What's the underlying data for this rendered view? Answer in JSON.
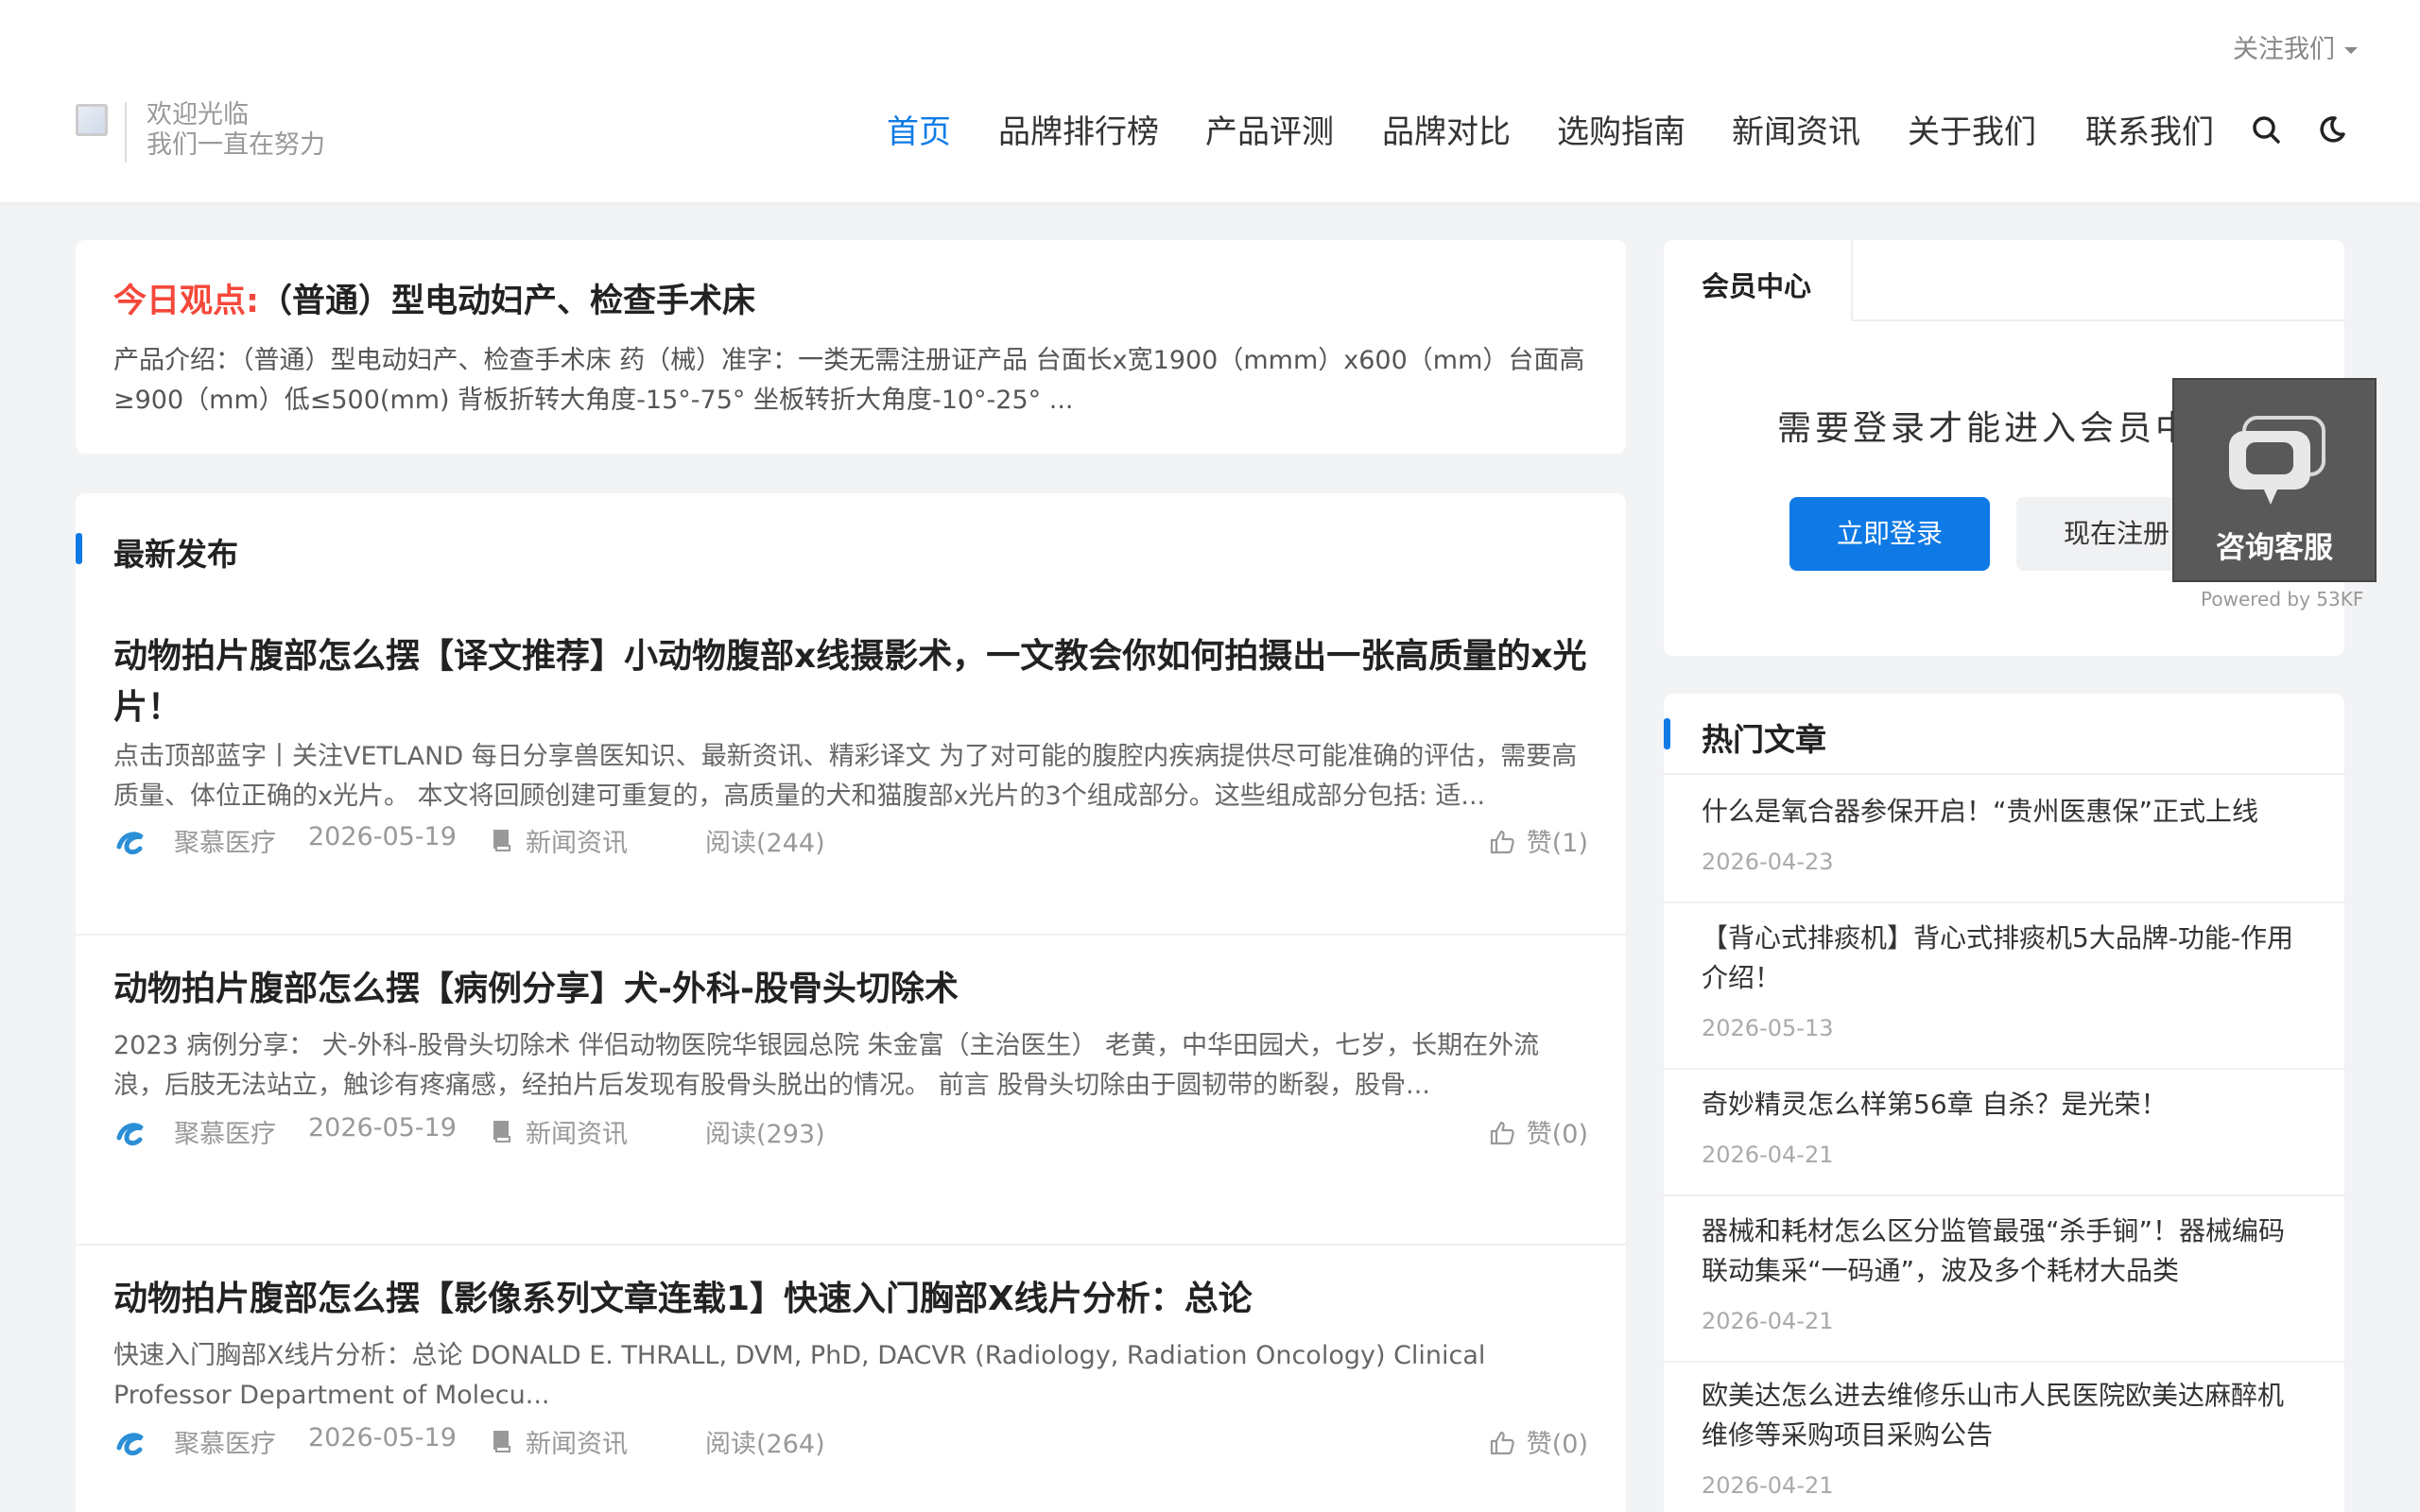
{
  "header": {
    "follow_label": "关注我们",
    "welcome_line1": "欢迎光临",
    "welcome_line2": "我们一直在努力"
  },
  "nav": {
    "items": [
      {
        "label": "首页",
        "active": true
      },
      {
        "label": "品牌排行榜"
      },
      {
        "label": "产品评测"
      },
      {
        "label": "品牌对比"
      },
      {
        "label": "选购指南"
      },
      {
        "label": "新闻资讯"
      },
      {
        "label": "关于我们"
      },
      {
        "label": "联系我们"
      }
    ],
    "icons": [
      "search-icon",
      "dark-mode-icon"
    ]
  },
  "today": {
    "lead": "今日观点:",
    "title": "（普通）型电动妇产、检查手术床",
    "desc": "产品介绍：（普通）型电动妇产、检查手术床 药（械）准字：一类无需注册证产品 台面长x宽1900（mmm）x600（mm）台面高≥900（mm）低≤500(mm) 背板折转大角度-15°-75° 坐板转折大角度-10°-25° ..."
  },
  "latest": {
    "heading": "最新发布",
    "articles": [
      {
        "title": "动物拍片腹部怎么摆【译文推荐】小动物腹部x线摄影术，一文教会你如何拍摄出一张高质量的x光片！",
        "desc": "点击顶部蓝字丨关注VETLAND 每日分享兽医知识、最新资讯、精彩译文 为了对可能的腹腔内疾病提供尽可能准确的评估，需要高质量、体位正确的x光片。 本文将回顾创建可重复的，高质量的犬和猫腹部x光片的3个组成部分。这些组成部分包括: 适...",
        "author": "聚慕医疗",
        "date": "2026-05-19",
        "category": "新闻资讯",
        "reads": "阅读(244)",
        "likes": "赞(1)"
      },
      {
        "title": "动物拍片腹部怎么摆【病例分享】犬-外科-股骨头切除术",
        "desc": "2023 病例分享： 犬-外科-股骨头切除术 伴侣动物医院华银园总院 朱金富（主治医生） 老黄，中华田园犬，七岁，长期在外流浪，后肢无法站立，触诊有疼痛感，经拍片后发现有股骨头脱出的情况。 前言 股骨头切除由于圆韧带的断裂，股骨...",
        "author": "聚慕医疗",
        "date": "2026-05-19",
        "category": "新闻资讯",
        "reads": "阅读(293)",
        "likes": "赞(0)"
      },
      {
        "title": "动物拍片腹部怎么摆【影像系列文章连载1】快速入门胸部X线片分析：总论",
        "desc": "快速入门胸部X线片分析：总论 DONALD E. THRALL, DVM, PhD, DACVR (Radiology, Radiation Oncology) Clinical Professor Department of Molecu...",
        "author": "聚慕医疗",
        "date": "2026-05-19",
        "category": "新闻资讯",
        "reads": "阅读(264)",
        "likes": "赞(0)"
      }
    ]
  },
  "member": {
    "tab": "会员中心",
    "message": "需要登录才能进入会员中心",
    "login_label": "立即登录",
    "register_label": "现在注册"
  },
  "hot": {
    "heading": "热门文章",
    "items": [
      {
        "title": "什么是氧合器参保开启！“贵州医惠保”正式上线",
        "date": "2026-04-23"
      },
      {
        "title": "【背心式排痰机】背心式排痰机5大品牌-功能-作用介绍！",
        "date": "2026-05-13"
      },
      {
        "title": "奇妙精灵怎么样第56章 自杀？是光荣！",
        "date": "2026-04-21"
      },
      {
        "title": "器械和耗材怎么区分监管最强“杀手锏”！器械编码联动集采“一码通”，波及多个耗材大品类",
        "date": "2026-04-21"
      },
      {
        "title": "欧美达怎么进去维修乐山市人民医院欧美达麻醉机维修等采购项目采购公告",
        "date": "2026-04-21"
      }
    ]
  },
  "kefu": {
    "label": "咨询客服",
    "powered": "Powered by 53KF"
  },
  "colors": {
    "accent": "#0f7ae5",
    "lead_red": "#f5483b"
  }
}
